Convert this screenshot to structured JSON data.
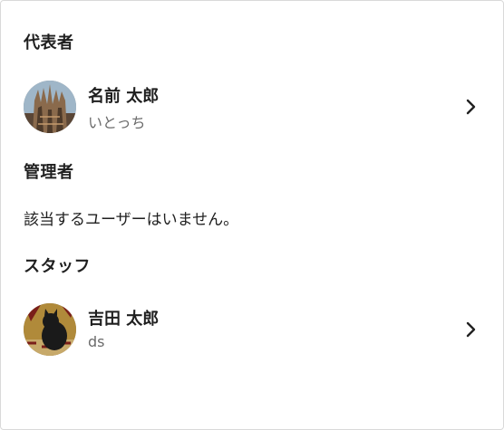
{
  "sections": {
    "representative": {
      "title": "代表者",
      "member": {
        "name": "名前 太郎",
        "sub": "いとっち",
        "avatar_icon": "cathedral-photo-avatar"
      }
    },
    "admin": {
      "title": "管理者",
      "empty_message": "該当するユーザーはいません。"
    },
    "staff": {
      "title": "スタッフ",
      "member": {
        "name": "吉田 太郎",
        "sub": "ds",
        "avatar_icon": "cat-photo-avatar"
      }
    }
  },
  "icons": {
    "row_action": "chevron-right-icon"
  }
}
